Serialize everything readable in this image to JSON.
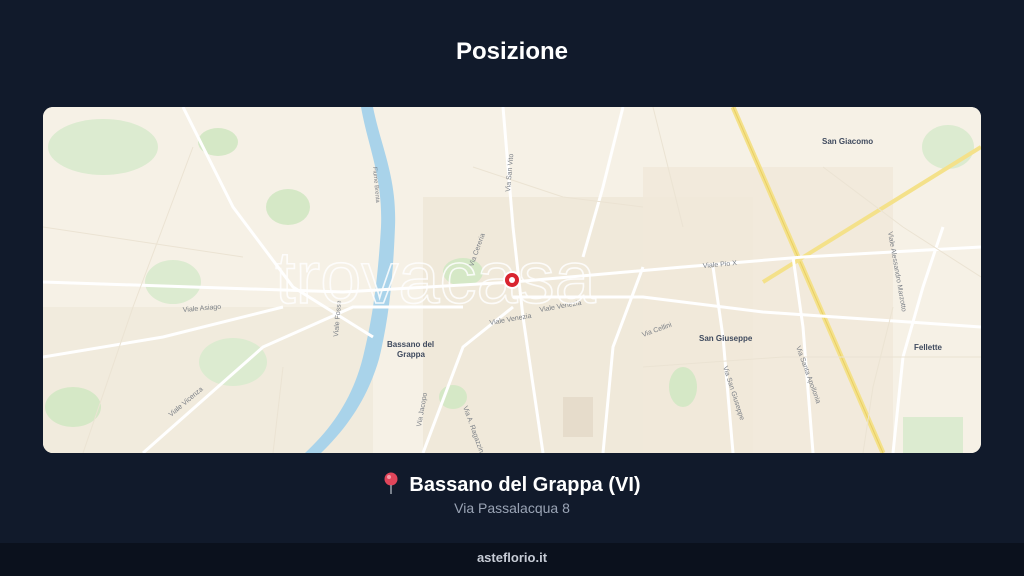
{
  "title": "Posizione",
  "map": {
    "watermark": "trovacasa",
    "places": {
      "bassano": "Bassano del",
      "bassano2": "Grappa",
      "san_giacomo": "San Giacomo",
      "san_giuseppe": "San Giuseppe",
      "fellette": "Fellette"
    },
    "streets": {
      "via_venezia": "Viale Venezia",
      "via_venezia2": "Viale Venezia",
      "viale_pio_x": "Viale Pio X",
      "via_san_vito": "Via San Vito",
      "viale_asiago": "Viale Asiago",
      "viale_vicenza": "Viale Vicenza",
      "via_san_giuseppe": "Via San Giuseppe",
      "via_cereria": "Via Cereria",
      "viale_fosse": "Viale Fosse",
      "fiume_brenta": "Fiume Brenta",
      "via_a_ragazzino": "Via A. Ragazzino",
      "via_cellini": "Via Cellini",
      "via_jacopo": "Via Jacopo",
      "viale_aless_marzotto": "Viale Alessandro Marzotto",
      "viale_monte_grappa": "Via Santa Apollonia"
    },
    "marker": "location-marker"
  },
  "location": {
    "city": "Bassano del Grappa (VI)",
    "address": "Via Passalacqua 8"
  },
  "footer": {
    "brand": "asteflorio.it"
  },
  "colors": {
    "background": "#111a2b",
    "footer_bg": "#0b111d",
    "map_bg": "#f6f1e6",
    "river": "#a9d3ea",
    "park": "#d5e8c6",
    "marker": "#d9242f",
    "highway": "#f4e18a"
  }
}
